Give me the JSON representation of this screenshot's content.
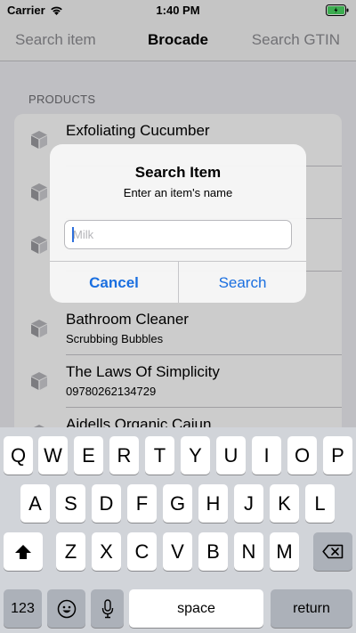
{
  "status_bar": {
    "carrier": "Carrier",
    "time": "1:40 PM",
    "battery_color": "#4cd964"
  },
  "nav": {
    "left_label": "Search item",
    "title": "Brocade",
    "right_label": "Search GTIN"
  },
  "products": {
    "section_header": "PRODUCTS",
    "items": [
      {
        "title": "Exfoliating Cucumber",
        "subtitle": ""
      },
      {
        "title": "",
        "subtitle": ""
      },
      {
        "title": "",
        "subtitle": ""
      },
      {
        "title": "Bathroom Cleaner",
        "subtitle": "Scrubbing Bubbles"
      },
      {
        "title": "The Laws Of Simplicity",
        "subtitle": "09780262134729"
      },
      {
        "title": "Aidells Organic Cajun",
        "subtitle": ""
      }
    ]
  },
  "alert": {
    "title": "Search Item",
    "message": "Enter an item's name",
    "placeholder": "Milk",
    "value": "",
    "cancel_label": "Cancel",
    "search_label": "Search",
    "accent_color": "#1a6fe0"
  },
  "keyboard": {
    "row1": [
      "Q",
      "W",
      "E",
      "R",
      "T",
      "Y",
      "U",
      "I",
      "O",
      "P"
    ],
    "row2": [
      "A",
      "S",
      "D",
      "F",
      "G",
      "H",
      "J",
      "K",
      "L"
    ],
    "row3": [
      "Z",
      "X",
      "C",
      "V",
      "B",
      "N",
      "M"
    ],
    "numbers_label": "123",
    "space_label": "space",
    "return_label": "return",
    "icons": {
      "shift": "shift-icon",
      "delete": "delete-icon",
      "emoji": "emoji-icon",
      "mic": "microphone-icon"
    }
  }
}
